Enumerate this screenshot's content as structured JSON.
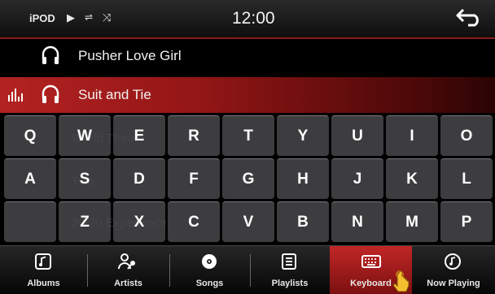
{
  "status": {
    "source": "iPOD",
    "play_icon": "play-icon",
    "repeat_icon": "repeat-icon",
    "shuffle_icon": "shuffle-icon",
    "time": "12:00",
    "back_icon": "back-arrow-icon"
  },
  "tracks": [
    {
      "title": "Pusher Love Girl",
      "active": false
    },
    {
      "title": "Suit and Tie",
      "active": true
    }
  ],
  "faded_rows": [
    "World Theory",
    "Two",
    "20/20 Experience"
  ],
  "keyboard": {
    "rows": [
      [
        "Q",
        "W",
        "E",
        "R",
        "T",
        "Y",
        "U",
        "I",
        "O"
      ],
      [
        "A",
        "S",
        "D",
        "F",
        "G",
        "H",
        "J",
        "K",
        "L"
      ],
      [
        "",
        "Z",
        "X",
        "C",
        "V",
        "B",
        "N",
        "M",
        "P"
      ]
    ]
  },
  "bottom_nav": [
    {
      "label": "Albums",
      "icon": "album-icon",
      "active": false
    },
    {
      "label": "Artists",
      "icon": "artist-icon",
      "active": false
    },
    {
      "label": "Songs",
      "icon": "disc-icon",
      "active": false
    },
    {
      "label": "Playlists",
      "icon": "playlist-icon",
      "active": false
    },
    {
      "label": "Keyboard",
      "icon": "keyboard-icon",
      "active": true
    },
    {
      "label": "Now Playing",
      "icon": "music-note-icon",
      "active": false
    }
  ],
  "colors": {
    "accent": "#b32222",
    "background": "#000000",
    "key": "#4e4e52"
  }
}
